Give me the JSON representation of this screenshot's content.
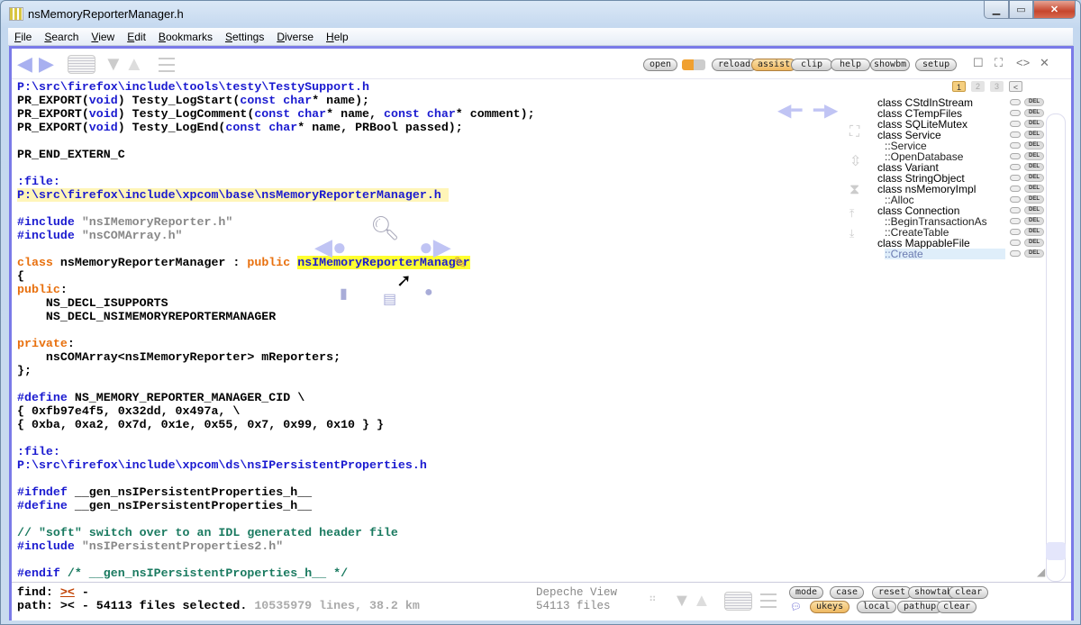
{
  "window": {
    "title": "nsMemoryReporterManager.h"
  },
  "menu": [
    {
      "u": "F",
      "rest": "ile"
    },
    {
      "u": "S",
      "rest": "earch"
    },
    {
      "u": "V",
      "rest": "iew"
    },
    {
      "u": "E",
      "rest": "dit"
    },
    {
      "u": "B",
      "rest": "ookmarks"
    },
    {
      "u": "S",
      "rest": "ettings"
    },
    {
      "u": "D",
      "rest": "iverse"
    },
    {
      "u": "H",
      "rest": "elp"
    }
  ],
  "toolbar": {
    "open": "open",
    "reload": "reload",
    "assist": "assist",
    "clip": "clip",
    "help": "help",
    "showbm": "showbm",
    "setup": "setup",
    "tabs": [
      "1",
      "2",
      "3"
    ]
  },
  "code": [
    [
      [
        "P:\\src\\firefox\\include\\tools\\testy\\TestySupport.h",
        "path"
      ]
    ],
    [
      [
        "PR_EXPORT(",
        ""
      ],
      [
        "void",
        "kw"
      ],
      [
        ") Testy_LogStart(",
        ""
      ],
      [
        "const",
        "kw"
      ],
      [
        " ",
        ""
      ],
      [
        "char",
        "kw"
      ],
      [
        "* name);",
        ""
      ]
    ],
    [
      [
        "PR_EXPORT(",
        ""
      ],
      [
        "void",
        "kw"
      ],
      [
        ") Testy_LogComment(",
        ""
      ],
      [
        "const",
        "kw"
      ],
      [
        " ",
        ""
      ],
      [
        "char",
        "kw"
      ],
      [
        "* name, ",
        ""
      ],
      [
        "const",
        "kw"
      ],
      [
        " ",
        ""
      ],
      [
        "char",
        "kw"
      ],
      [
        "* comment);",
        ""
      ]
    ],
    [
      [
        "PR_EXPORT(",
        ""
      ],
      [
        "void",
        "kw"
      ],
      [
        ") Testy_LogEnd(",
        ""
      ],
      [
        "const",
        "kw"
      ],
      [
        " ",
        ""
      ],
      [
        "char",
        "kw"
      ],
      [
        "* name, PRBool passed);",
        ""
      ]
    ],
    [],
    [
      [
        "PR_END_EXTERN_C",
        ""
      ]
    ],
    [],
    [
      [
        ":file:",
        "file"
      ]
    ],
    [
      [
        "P:\\src\\firefox\\include\\xpcom\\base\\nsMemoryReporterManager.h ",
        "path hl"
      ]
    ],
    [],
    [
      [
        "#include",
        "pp"
      ],
      [
        " \"nsIMemoryReporter.h\"",
        "str"
      ]
    ],
    [
      [
        "#include",
        "pp"
      ],
      [
        " \"nsCOMArray.h\"",
        "str"
      ]
    ],
    [],
    [
      [
        "class",
        "cls"
      ],
      [
        " nsMemoryReporterManager : ",
        ""
      ],
      [
        "public",
        "cls"
      ],
      [
        " ",
        ""
      ],
      [
        "nsIMemoryReporterManager",
        "sel"
      ]
    ],
    [
      [
        "{",
        ""
      ]
    ],
    [
      [
        "public",
        "cls"
      ],
      [
        ":",
        ""
      ]
    ],
    [
      [
        "    NS_DECL_ISUPPORTS",
        ""
      ]
    ],
    [
      [
        "    NS_DECL_NSIMEMORYREPORTERMANAGER",
        ""
      ]
    ],
    [],
    [
      [
        "private",
        "cls"
      ],
      [
        ":",
        ""
      ]
    ],
    [
      [
        "    nsCOMArray<nsIMemoryReporter> mReporters;",
        ""
      ]
    ],
    [
      [
        "};",
        ""
      ]
    ],
    [],
    [
      [
        "#define",
        "pp"
      ],
      [
        " NS_MEMORY_REPORTER_MANAGER_CID \\",
        ""
      ]
    ],
    [
      [
        "{ 0xfb97e4f5, 0x32dd, 0x497a, \\",
        ""
      ]
    ],
    [
      [
        "{ 0xba, 0xa2, 0x7d, 0x1e, 0x55, 0x7, 0x99, 0x10 } }",
        ""
      ]
    ],
    [],
    [
      [
        ":file:",
        "file"
      ]
    ],
    [
      [
        "P:\\src\\firefox\\include\\xpcom\\ds\\nsIPersistentProperties.h",
        "path"
      ]
    ],
    [],
    [
      [
        "#ifndef",
        "pp"
      ],
      [
        " __gen_nsIPersistentProperties_h__",
        ""
      ]
    ],
    [
      [
        "#define",
        "pp"
      ],
      [
        " __gen_nsIPersistentProperties_h__",
        ""
      ]
    ],
    [],
    [
      [
        "// \"soft\" switch over to an IDL generated header file",
        "cmt"
      ]
    ],
    [
      [
        "#include",
        "pp"
      ],
      [
        " \"nsIPersistentProperties2.h\"",
        "str"
      ]
    ],
    [],
    [
      [
        "#endif",
        "pp"
      ],
      [
        " /* __gen_nsIPersistentProperties_h__ */",
        "cmt"
      ]
    ]
  ],
  "outline": {
    "del_label": "DEL",
    "items": [
      {
        "label": "class CStdInStream",
        "sub": false
      },
      {
        "label": "class CTempFiles",
        "sub": false
      },
      {
        "label": "class SQLiteMutex",
        "sub": false
      },
      {
        "label": "class Service",
        "sub": false
      },
      {
        "label": "::Service",
        "sub": true
      },
      {
        "label": "::OpenDatabase",
        "sub": true
      },
      {
        "label": "class Variant",
        "sub": false
      },
      {
        "label": "class StringObject",
        "sub": false
      },
      {
        "label": "class nsMemoryImpl",
        "sub": false
      },
      {
        "label": "::Alloc",
        "sub": true
      },
      {
        "label": "class Connection",
        "sub": false
      },
      {
        "label": "::BeginTransactionAs",
        "sub": true
      },
      {
        "label": "::CreateTable",
        "sub": true
      },
      {
        "label": "class MappableFile",
        "sub": false
      },
      {
        "label": "::Create",
        "sub": true,
        "selected": true
      }
    ]
  },
  "status": {
    "find_label": "find: ",
    "find_value": "><",
    "find_rest": " -",
    "path_label": "path: >< - 54113 files selected. ",
    "path_stats": "10535979 lines, 38.2 km",
    "view_name": "Depeche View",
    "view_files": "54113 files",
    "buttons_row1": [
      "mode",
      "case",
      "reset",
      "showtab",
      "clear"
    ],
    "buttons_row2": [
      "ukeys",
      "local",
      "pathup",
      "clear"
    ]
  }
}
